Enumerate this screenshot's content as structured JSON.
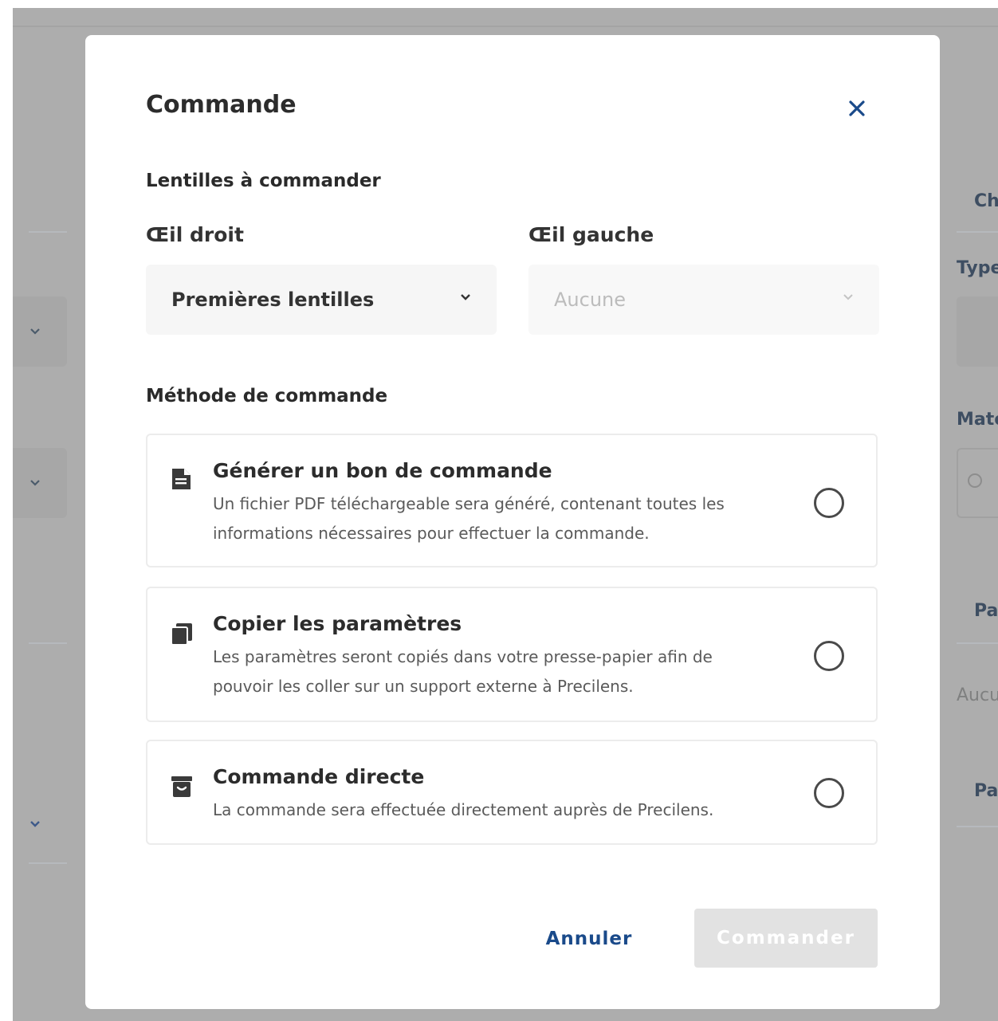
{
  "modal": {
    "title": "Commande",
    "lenses_section": "Lentilles à commander",
    "right_eye": {
      "label": "Œil droit",
      "value": "Premières lentilles"
    },
    "left_eye": {
      "label": "Œil gauche",
      "value": "Aucune"
    },
    "method_section": "Méthode de commande",
    "options": [
      {
        "title": "Générer un bon de commande",
        "description_line1": "Un fichier PDF téléchargeable sera généré, contenant toutes les",
        "description_line2": "informations nécessaires pour effectuer la commande.",
        "icon": "document-icon",
        "selected": false
      },
      {
        "title": "Copier les paramètres",
        "description_line1": "Les paramètres seront copiés dans votre presse-papier afin de",
        "description_line2": "pouvoir les coller sur un support externe à Precilens.",
        "icon": "copy-icon",
        "selected": false
      },
      {
        "title": "Commande directe",
        "description_line1": "La commande sera effectuée directement auprès de Precilens.",
        "icon": "package-icon",
        "selected": false
      }
    ],
    "cancel_label": "Annuler",
    "submit_label": "Commander"
  },
  "background": {
    "right_fragments": [
      "Ch",
      "Type",
      "Maté",
      "Pa",
      "Aucu",
      "Pa"
    ]
  },
  "colors": {
    "accent": "#1a4a8a",
    "backdrop": "#adadad",
    "disabled_button": "#e2e2e2"
  }
}
